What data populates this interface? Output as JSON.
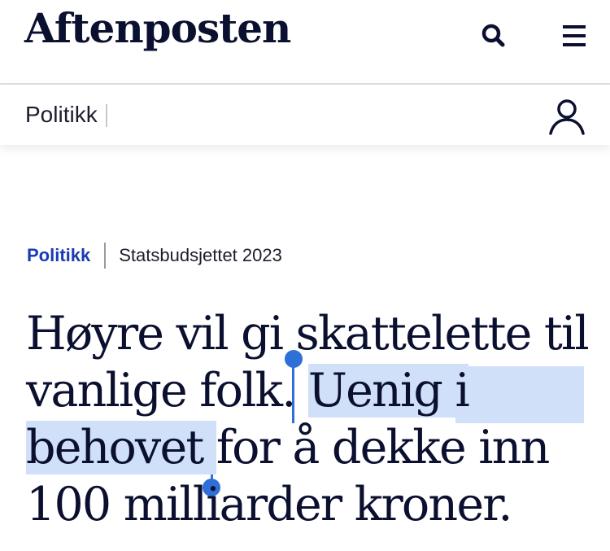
{
  "header": {
    "logo_text": "Aftenposten",
    "search_icon": "search-icon",
    "menu_icon": "hamburger-menu-icon"
  },
  "section_bar": {
    "label": "Politikk",
    "profile_icon": "user-profile-icon"
  },
  "article": {
    "section": "Politikk",
    "topic": "Statsbudsjettet 2023",
    "headline_parts": {
      "line1": "Høyre vil gi skattelette til",
      "line2_plain": "vanlige folk. ",
      "line2_selected": "Uenig i",
      "line3_selected": "behovet ",
      "line3_plain": "for å dekke inn",
      "line4": "100 milliarder kroner."
    }
  },
  "colors": {
    "accent_section": "#1a3bb5",
    "headline_text": "#0b1030",
    "selection_highlight": "#cfe0f8",
    "selection_handle": "#2f6fd8"
  }
}
